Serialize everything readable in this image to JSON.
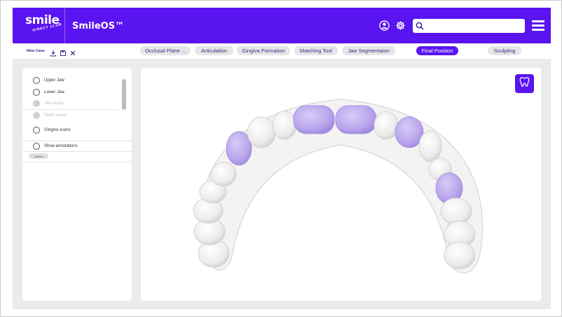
{
  "brand": {
    "logo_main": "smile",
    "logo_sub": "DIRECT CLUB",
    "app_title": "SmileOS™",
    "accent_color": "#5a14f0"
  },
  "header": {
    "icons": [
      "user-icon",
      "gear-icon",
      "search-icon",
      "menu-icon"
    ],
    "search": {
      "value": "",
      "placeholder": ""
    }
  },
  "toolbar": {
    "new_case_label": "New Case",
    "icons": [
      "download-icon",
      "save-icon",
      "close-icon"
    ],
    "tabs": [
      {
        "label": "Occlusal Plane ...",
        "active": false
      },
      {
        "label": "Articulation",
        "active": false
      },
      {
        "label": "Gingiva Formation",
        "active": false
      },
      {
        "label": "Matching Tool",
        "active": false
      },
      {
        "label": "Jaw Segmentaion",
        "active": false
      },
      {
        "label": "Final Position",
        "active": true
      },
      {
        "label": "Sculpting",
        "active": false
      }
    ]
  },
  "layers_panel": {
    "items": [
      {
        "label": "Upper Jaw",
        "enabled": true
      },
      {
        "label": "Lower Jaw",
        "enabled": true
      },
      {
        "label": "Jaw scans",
        "enabled": false
      },
      {
        "label": "Teeth scans",
        "enabled": false
      },
      {
        "label": "Gingiva scans",
        "enabled": true
      },
      {
        "label": "Show annotations",
        "enabled": true
      }
    ],
    "small_button_label": "Utilities"
  },
  "viewer": {
    "tooth_button_icon": "tooth-icon",
    "highlight_color": "#b9a4ec"
  }
}
